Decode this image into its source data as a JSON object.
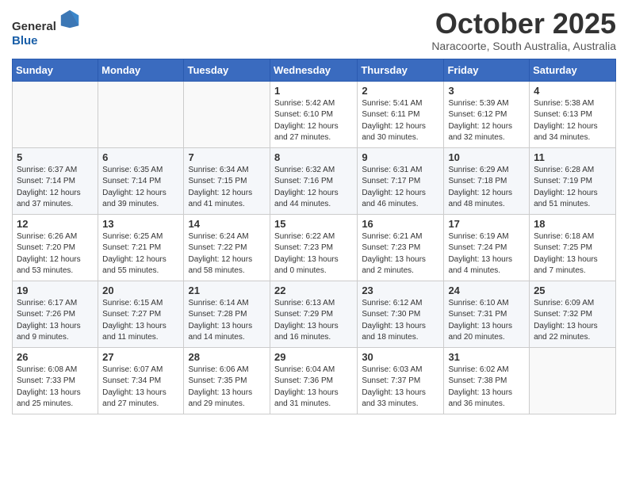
{
  "header": {
    "logo_general": "General",
    "logo_blue": "Blue",
    "month_title": "October 2025",
    "location": "Naracoorte, South Australia, Australia"
  },
  "days_of_week": [
    "Sunday",
    "Monday",
    "Tuesday",
    "Wednesday",
    "Thursday",
    "Friday",
    "Saturday"
  ],
  "weeks": [
    [
      {
        "day": "",
        "info": ""
      },
      {
        "day": "",
        "info": ""
      },
      {
        "day": "",
        "info": ""
      },
      {
        "day": "1",
        "info": "Sunrise: 5:42 AM\nSunset: 6:10 PM\nDaylight: 12 hours\nand 27 minutes."
      },
      {
        "day": "2",
        "info": "Sunrise: 5:41 AM\nSunset: 6:11 PM\nDaylight: 12 hours\nand 30 minutes."
      },
      {
        "day": "3",
        "info": "Sunrise: 5:39 AM\nSunset: 6:12 PM\nDaylight: 12 hours\nand 32 minutes."
      },
      {
        "day": "4",
        "info": "Sunrise: 5:38 AM\nSunset: 6:13 PM\nDaylight: 12 hours\nand 34 minutes."
      }
    ],
    [
      {
        "day": "5",
        "info": "Sunrise: 6:37 AM\nSunset: 7:14 PM\nDaylight: 12 hours\nand 37 minutes."
      },
      {
        "day": "6",
        "info": "Sunrise: 6:35 AM\nSunset: 7:14 PM\nDaylight: 12 hours\nand 39 minutes."
      },
      {
        "day": "7",
        "info": "Sunrise: 6:34 AM\nSunset: 7:15 PM\nDaylight: 12 hours\nand 41 minutes."
      },
      {
        "day": "8",
        "info": "Sunrise: 6:32 AM\nSunset: 7:16 PM\nDaylight: 12 hours\nand 44 minutes."
      },
      {
        "day": "9",
        "info": "Sunrise: 6:31 AM\nSunset: 7:17 PM\nDaylight: 12 hours\nand 46 minutes."
      },
      {
        "day": "10",
        "info": "Sunrise: 6:29 AM\nSunset: 7:18 PM\nDaylight: 12 hours\nand 48 minutes."
      },
      {
        "day": "11",
        "info": "Sunrise: 6:28 AM\nSunset: 7:19 PM\nDaylight: 12 hours\nand 51 minutes."
      }
    ],
    [
      {
        "day": "12",
        "info": "Sunrise: 6:26 AM\nSunset: 7:20 PM\nDaylight: 12 hours\nand 53 minutes."
      },
      {
        "day": "13",
        "info": "Sunrise: 6:25 AM\nSunset: 7:21 PM\nDaylight: 12 hours\nand 55 minutes."
      },
      {
        "day": "14",
        "info": "Sunrise: 6:24 AM\nSunset: 7:22 PM\nDaylight: 12 hours\nand 58 minutes."
      },
      {
        "day": "15",
        "info": "Sunrise: 6:22 AM\nSunset: 7:23 PM\nDaylight: 13 hours\nand 0 minutes."
      },
      {
        "day": "16",
        "info": "Sunrise: 6:21 AM\nSunset: 7:23 PM\nDaylight: 13 hours\nand 2 minutes."
      },
      {
        "day": "17",
        "info": "Sunrise: 6:19 AM\nSunset: 7:24 PM\nDaylight: 13 hours\nand 4 minutes."
      },
      {
        "day": "18",
        "info": "Sunrise: 6:18 AM\nSunset: 7:25 PM\nDaylight: 13 hours\nand 7 minutes."
      }
    ],
    [
      {
        "day": "19",
        "info": "Sunrise: 6:17 AM\nSunset: 7:26 PM\nDaylight: 13 hours\nand 9 minutes."
      },
      {
        "day": "20",
        "info": "Sunrise: 6:15 AM\nSunset: 7:27 PM\nDaylight: 13 hours\nand 11 minutes."
      },
      {
        "day": "21",
        "info": "Sunrise: 6:14 AM\nSunset: 7:28 PM\nDaylight: 13 hours\nand 14 minutes."
      },
      {
        "day": "22",
        "info": "Sunrise: 6:13 AM\nSunset: 7:29 PM\nDaylight: 13 hours\nand 16 minutes."
      },
      {
        "day": "23",
        "info": "Sunrise: 6:12 AM\nSunset: 7:30 PM\nDaylight: 13 hours\nand 18 minutes."
      },
      {
        "day": "24",
        "info": "Sunrise: 6:10 AM\nSunset: 7:31 PM\nDaylight: 13 hours\nand 20 minutes."
      },
      {
        "day": "25",
        "info": "Sunrise: 6:09 AM\nSunset: 7:32 PM\nDaylight: 13 hours\nand 22 minutes."
      }
    ],
    [
      {
        "day": "26",
        "info": "Sunrise: 6:08 AM\nSunset: 7:33 PM\nDaylight: 13 hours\nand 25 minutes."
      },
      {
        "day": "27",
        "info": "Sunrise: 6:07 AM\nSunset: 7:34 PM\nDaylight: 13 hours\nand 27 minutes."
      },
      {
        "day": "28",
        "info": "Sunrise: 6:06 AM\nSunset: 7:35 PM\nDaylight: 13 hours\nand 29 minutes."
      },
      {
        "day": "29",
        "info": "Sunrise: 6:04 AM\nSunset: 7:36 PM\nDaylight: 13 hours\nand 31 minutes."
      },
      {
        "day": "30",
        "info": "Sunrise: 6:03 AM\nSunset: 7:37 PM\nDaylight: 13 hours\nand 33 minutes."
      },
      {
        "day": "31",
        "info": "Sunrise: 6:02 AM\nSunset: 7:38 PM\nDaylight: 13 hours\nand 36 minutes."
      },
      {
        "day": "",
        "info": ""
      }
    ]
  ]
}
